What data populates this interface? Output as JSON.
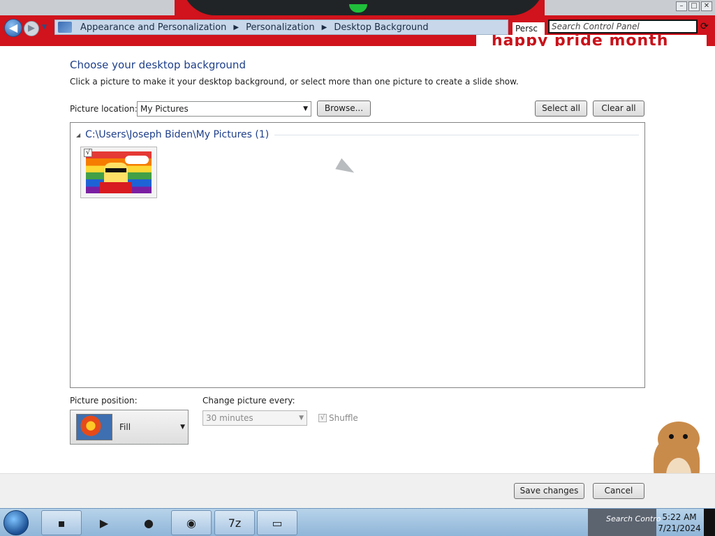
{
  "window": {
    "nav_back_glyph": "◀",
    "nav_forward_glyph": "▶",
    "breadcrumbs": [
      "Appearance and Personalization",
      "Personalization",
      "Desktop Background"
    ],
    "personalization_chip": "Persc",
    "search_placeholder": "Search Control Panel",
    "overlay_text": "happy pride month",
    "minimize_glyph": "–",
    "maximize_glyph": "□",
    "close_glyph": "✕"
  },
  "main": {
    "heading": "Choose your desktop background",
    "subtext": "Click a picture to make it your desktop background, or select more than one picture to create a slide show.",
    "picture_location_label": "Picture location:",
    "picture_location_value": "My Pictures",
    "browse_label": "Browse...",
    "select_all_label": "Select all",
    "clear_all_label": "Clear all",
    "group_title": "C:\\Users\\Joseph Biden\\My Pictures (1)",
    "thumbnail_checked": "√",
    "picture_position_label": "Picture position:",
    "picture_position_value": "Fill",
    "change_every_label": "Change picture every:",
    "change_every_value": "30 minutes",
    "shuffle_label": "Shuffle",
    "shuffle_checked": "√"
  },
  "footer": {
    "save_label": "Save changes",
    "cancel_label": "Cancel"
  },
  "taskbar": {
    "items": [
      {
        "icon": "terminal-icon",
        "glyph": "▪"
      },
      {
        "icon": "media-player-icon",
        "glyph": "▶"
      },
      {
        "icon": "globe-icon",
        "glyph": "●"
      },
      {
        "icon": "firefox-icon",
        "glyph": "◉"
      },
      {
        "icon": "7zip-icon",
        "glyph": "7z"
      },
      {
        "icon": "window-icon",
        "glyph": "▭"
      }
    ],
    "tray_text": "Search Contro",
    "time": "5:22 AM",
    "date": "7/21/2024"
  },
  "colors": {
    "title_bar": "#d0131c",
    "heading": "#1e3f8a",
    "taskbar": "#9fc0e0"
  }
}
